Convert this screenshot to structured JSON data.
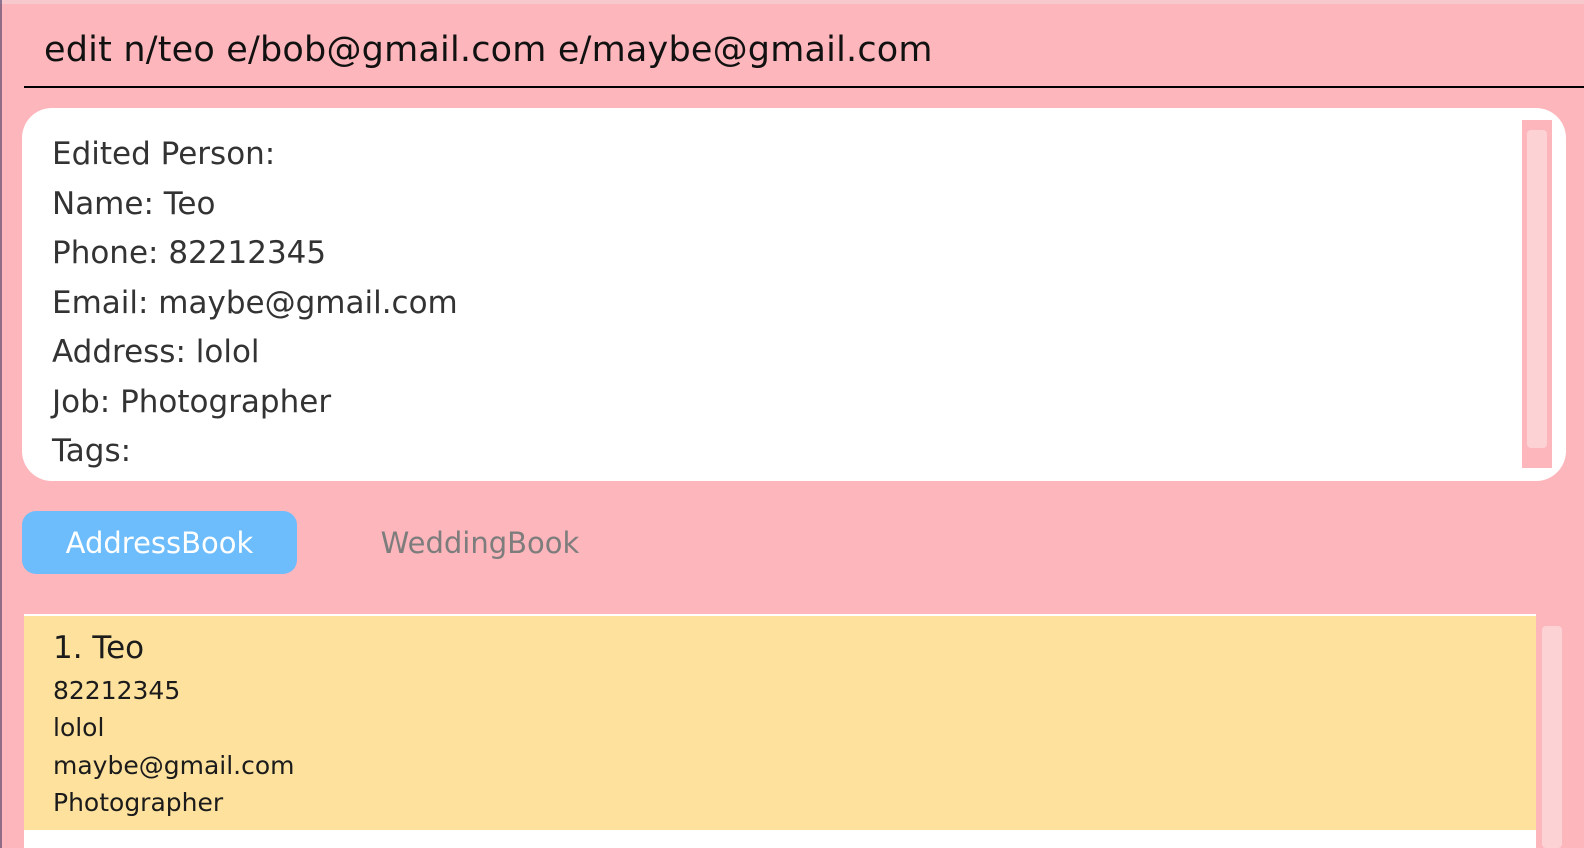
{
  "command": {
    "text": "edit n/teo e/bob@gmail.com e/maybe@gmail.com"
  },
  "result": {
    "lines": [
      "Edited Person:",
      "Name: Teo",
      "Phone: 82212345",
      "Email: maybe@gmail.com",
      "Address: lolol",
      "Job: Photographer",
      "Tags:"
    ]
  },
  "tabs": [
    {
      "label": "AddressBook",
      "active": true
    },
    {
      "label": "WeddingBook",
      "active": false
    }
  ],
  "person_list": [
    {
      "title": "1. Teo",
      "phone": "82212345",
      "address": "lolol",
      "email": "maybe@gmail.com",
      "job": "Photographer"
    }
  ],
  "colors": {
    "background": "#fdb6bb",
    "active_tab": "#6dbcfc",
    "card": "#fde19d"
  }
}
